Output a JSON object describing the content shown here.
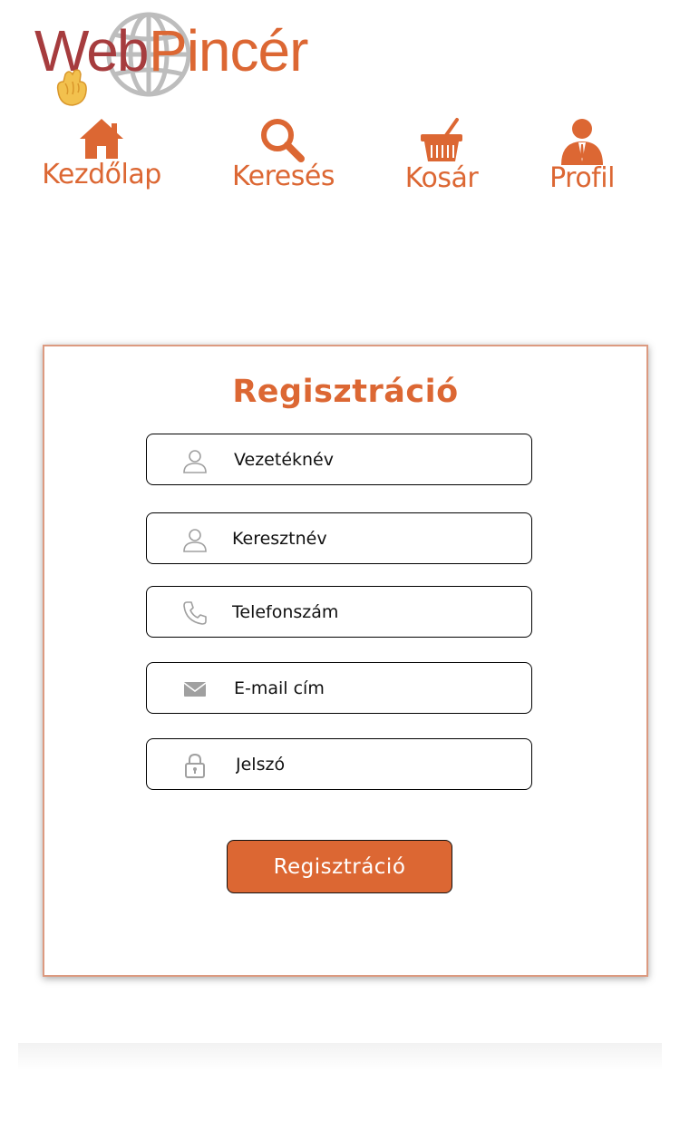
{
  "logo": {
    "part1": "Web",
    "part2": "Pincér"
  },
  "nav": {
    "items": [
      {
        "label": "Kezdőlap",
        "icon": "home-icon"
      },
      {
        "label": "Keresés",
        "icon": "search-icon"
      },
      {
        "label": "Kosár",
        "icon": "basket-icon"
      },
      {
        "label": "Profil",
        "icon": "user-icon"
      }
    ]
  },
  "form": {
    "title": "Regisztráció",
    "fields": [
      {
        "placeholder": "Vezetéknév",
        "icon": "user-outline-icon"
      },
      {
        "placeholder": "Keresztnév",
        "icon": "user-outline-icon"
      },
      {
        "placeholder": "Telefonszám",
        "icon": "phone-icon"
      },
      {
        "placeholder": "E-mail cím",
        "icon": "envelope-icon"
      },
      {
        "placeholder": "Jelszó",
        "icon": "lock-icon"
      }
    ],
    "submit_label": "Regisztráció"
  },
  "colors": {
    "accent": "#dc6733",
    "logo_dark_red": "#a63c3e",
    "icon_gray": "#a0a0a0"
  }
}
